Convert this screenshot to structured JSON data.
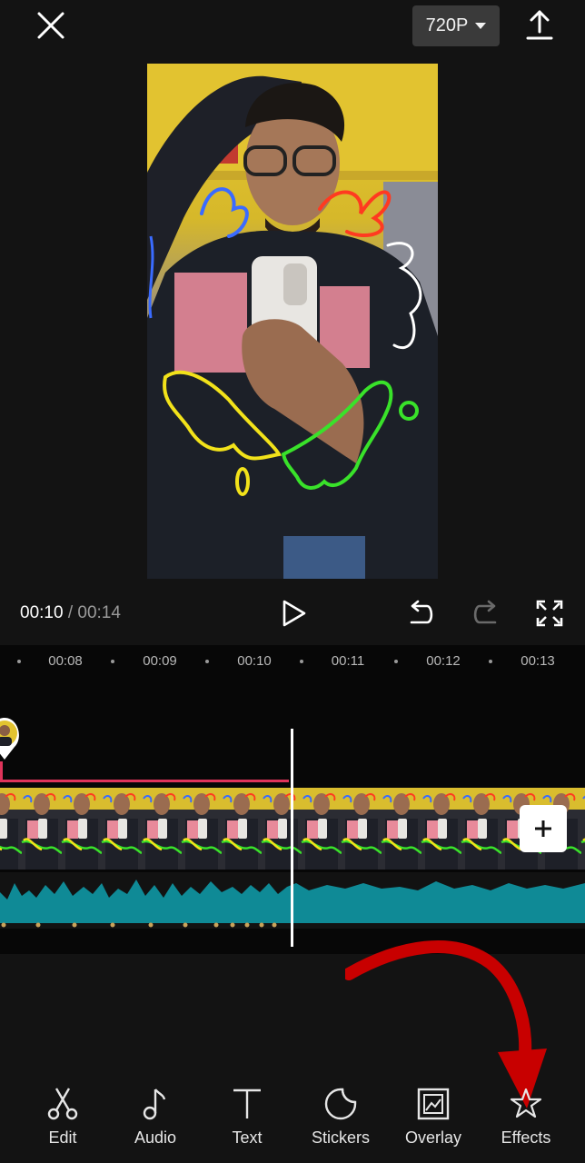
{
  "topbar": {
    "close_icon": "close-icon",
    "resolution_label": "720P",
    "export_icon": "upload-icon"
  },
  "playback": {
    "current_time": "00:10",
    "separator": "/",
    "total_time": "00:14"
  },
  "ruler": {
    "ticks": [
      "00:08",
      "00:09",
      "00:10",
      "00:11",
      "00:12",
      "00:13"
    ]
  },
  "toolbar": {
    "items": [
      {
        "label": "Edit",
        "icon": "scissors-icon"
      },
      {
        "label": "Audio",
        "icon": "music-note-icon"
      },
      {
        "label": "Text",
        "icon": "text-icon"
      },
      {
        "label": "Stickers",
        "icon": "sticker-icon"
      },
      {
        "label": "Overlay",
        "icon": "overlay-icon"
      },
      {
        "label": "Effects",
        "icon": "effects-star-icon"
      }
    ]
  },
  "colors": {
    "accent_red": "#e0345a",
    "audio_wave": "#0f8a96",
    "arrow_red": "#c80000"
  }
}
